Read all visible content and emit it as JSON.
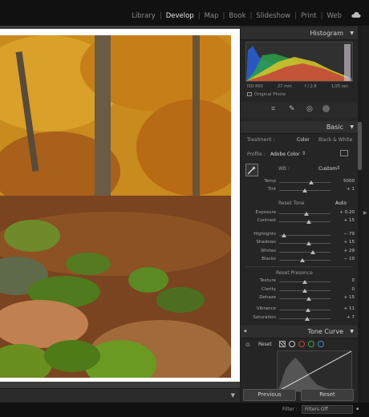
{
  "app": {
    "modules": [
      "Library",
      "Develop",
      "Map",
      "Book",
      "Slideshow",
      "Print",
      "Web"
    ],
    "active_module": "Develop"
  },
  "histogram": {
    "title": "Histogram",
    "iso": "ISO 800",
    "focal": "27 mm",
    "aperture": "f / 2.8",
    "shutter": "1/25 sec",
    "original_photo": "Original Photo"
  },
  "basic": {
    "title": "Basic",
    "treatment_label": "Treatment :",
    "treatment_color": "Color",
    "treatment_bw": "Black & White",
    "profile_label": "Profile :",
    "profile_value": "Adobe Color",
    "wb_label": "WB :",
    "wb_value": "Custom",
    "temp": {
      "label": "Temp",
      "value": "5000",
      "pos": 0.62
    },
    "tint": {
      "label": "Tint",
      "value": "+ 1",
      "pos": 0.5
    },
    "tone_label": "Reset Tone",
    "auto_label": "Auto",
    "exposure": {
      "label": "Exposure",
      "value": "+ 0.20",
      "pos": 0.53
    },
    "contrast": {
      "label": "Contrast",
      "value": "+ 15",
      "pos": 0.58
    },
    "highlights": {
      "label": "Highlights",
      "value": "− 79",
      "pos": 0.1
    },
    "shadows": {
      "label": "Shadows",
      "value": "+ 15",
      "pos": 0.58
    },
    "whites": {
      "label": "Whites",
      "value": "+ 29",
      "pos": 0.65
    },
    "blacks": {
      "label": "Blacks",
      "value": "− 10",
      "pos": 0.45
    },
    "presence_label": "Reset Presence",
    "texture": {
      "label": "Texture",
      "value": "0",
      "pos": 0.5
    },
    "clarity": {
      "label": "Clarity",
      "value": "0",
      "pos": 0.5
    },
    "dehaze": {
      "label": "Dehaze",
      "value": "+ 15",
      "pos": 0.58
    },
    "vibrance": {
      "label": "Vibrance",
      "value": "+ 11",
      "pos": 0.56
    },
    "saturation": {
      "label": "Saturation",
      "value": "+ 7",
      "pos": 0.54
    }
  },
  "tone_curve": {
    "title": "Tone Curve",
    "reset_label": "Reset"
  },
  "buttons": {
    "previous": "Previous",
    "reset": "Reset"
  },
  "footer": {
    "filter_label": "Filter :",
    "filter_value": "Filters Off"
  },
  "colors": {
    "accent": "#3a6fc4",
    "panel": "#252525"
  }
}
